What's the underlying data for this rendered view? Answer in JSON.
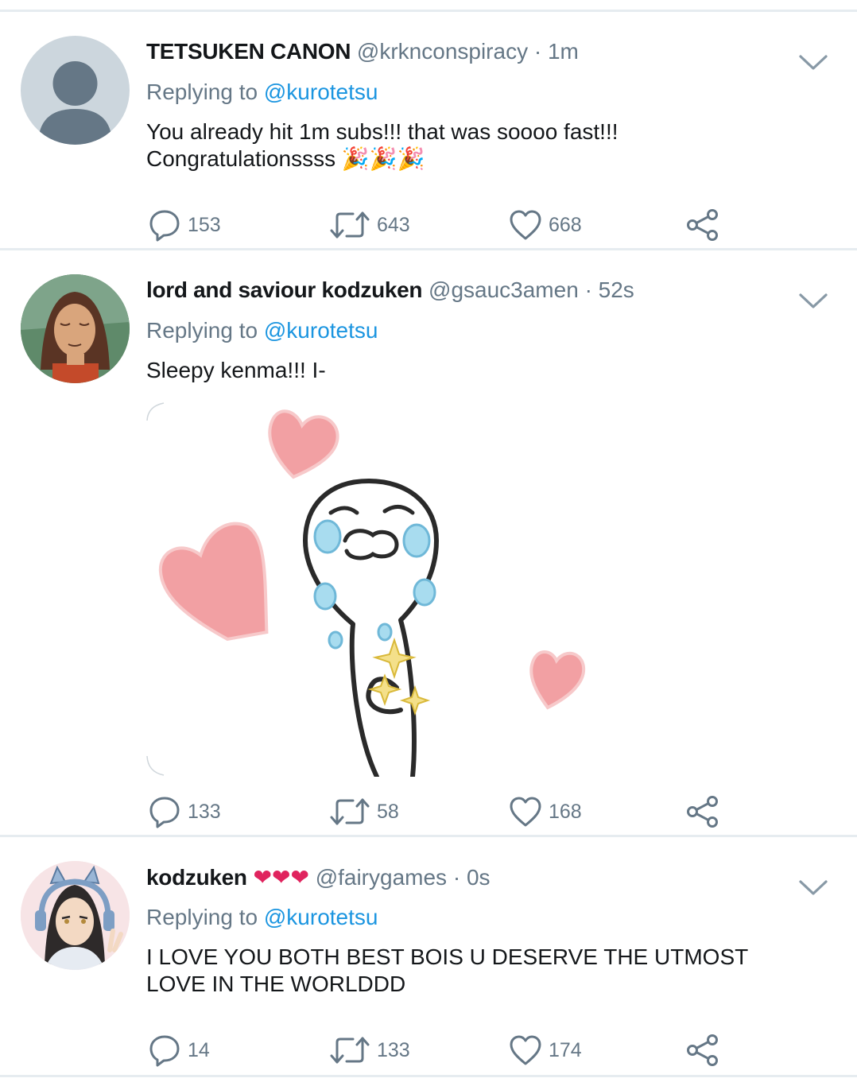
{
  "tweets": [
    {
      "name": "TETSUKEN CANON",
      "handle": "@krknconspiracy",
      "time": "· 1m",
      "replying_prefix": "Replying to",
      "replying_to": "@kurotetsu",
      "text_lines": [
        "You already hit 1m subs!!! that was soooo fast!!!",
        "Congratulationssss 🎉🎉🎉"
      ],
      "replies": "153",
      "retweets": "643",
      "likes": "668"
    },
    {
      "name": "lord and saviour kodzuken",
      "handle": "@gsauc3amen",
      "time": "· 52s",
      "replying_prefix": "Replying to",
      "replying_to": "@kurotetsu",
      "text_lines": [
        "Sleepy kenma!!! I-"
      ],
      "replies": "133",
      "retweets": "58",
      "likes": "168"
    },
    {
      "name": "kodzuken",
      "name_hearts": "❤❤❤",
      "handle": "@fairygames",
      "time": "· 0s",
      "replying_prefix": "Replying to",
      "replying_to": "@kurotetsu",
      "text_lines": [
        "I LOVE YOU BOTH BEST BOIS U DESERVE THE UTMOST",
        "LOVE IN THE WORLDDD"
      ],
      "replies": "14",
      "retweets": "133",
      "likes": "174"
    }
  ],
  "icons": {
    "reply": "reply-bubble-icon",
    "retweet": "retweet-icon",
    "like": "heart-icon",
    "share": "share-icon",
    "more": "chevron-down-icon"
  },
  "colors": {
    "mention": "#1b95e0",
    "secondary_text": "#657786",
    "divider": "#e6ecf0",
    "heart_red": "#e0245e"
  }
}
